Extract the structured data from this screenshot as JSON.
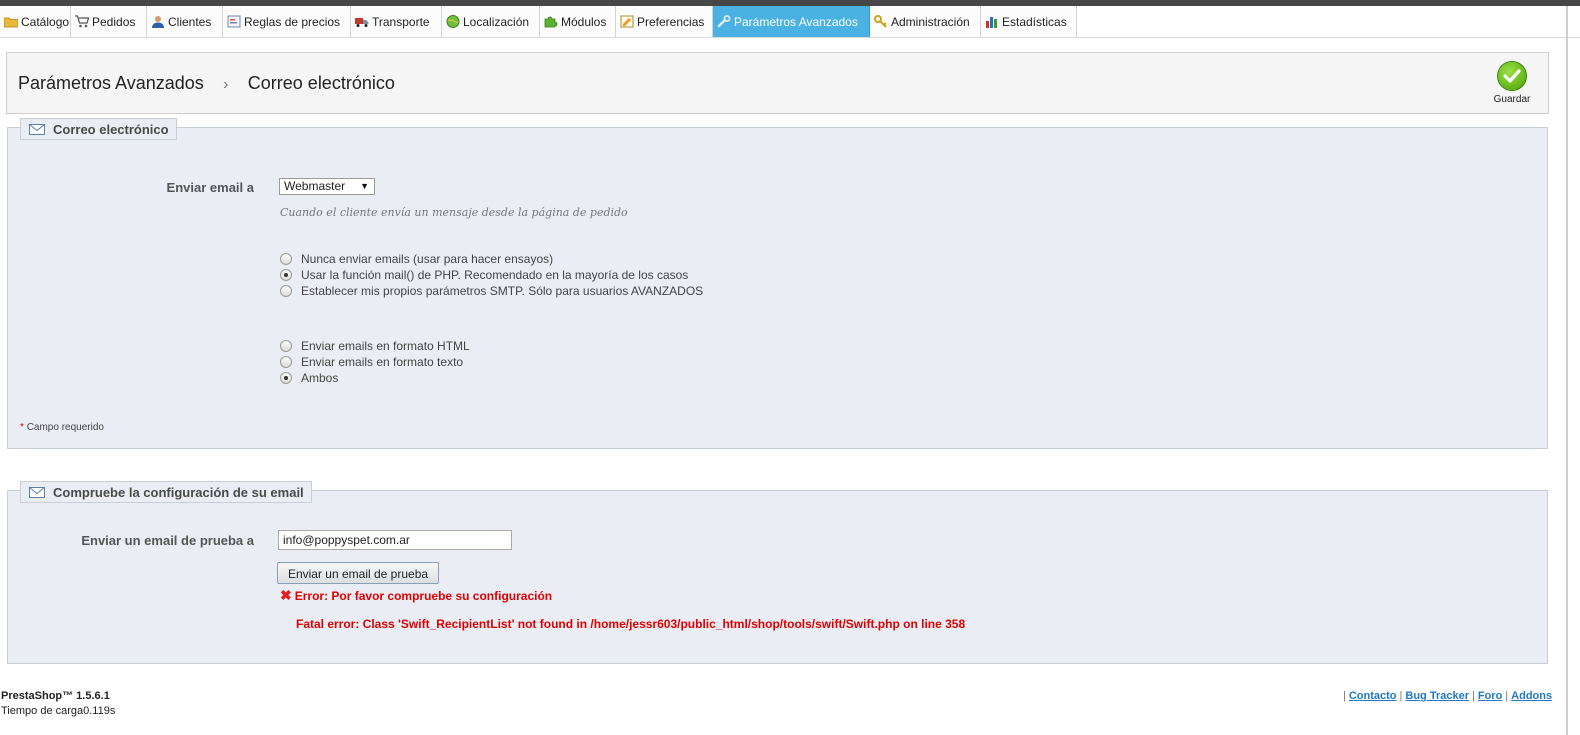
{
  "menu": {
    "tabs": [
      {
        "label": "Catálogo",
        "icon": "folder-icon",
        "active": false
      },
      {
        "label": "Pedidos",
        "icon": "cart-icon",
        "active": false
      },
      {
        "label": "Clientes",
        "icon": "user-icon",
        "active": false
      },
      {
        "label": "Reglas de precios",
        "icon": "price-rules-icon",
        "active": false
      },
      {
        "label": "Transporte",
        "icon": "truck-icon",
        "active": false
      },
      {
        "label": "Localización",
        "icon": "globe-icon",
        "active": false
      },
      {
        "label": "Módulos",
        "icon": "puzzle-icon",
        "active": false
      },
      {
        "label": "Preferencias",
        "icon": "preferences-icon",
        "active": false
      },
      {
        "label": "Parámetros Avanzados",
        "icon": "wrench-icon",
        "active": true
      },
      {
        "label": "Administración",
        "icon": "key-icon",
        "active": false
      },
      {
        "label": "Estadísticas",
        "icon": "bar-chart-icon",
        "active": false
      }
    ],
    "active_color": "#49b2e3"
  },
  "breadcrumb": {
    "parent": "Parámetros Avanzados",
    "separator": "›",
    "current": "Correo electrónico"
  },
  "toolbar": {
    "save_label": "Guardar",
    "save_icon": "checkmark-icon",
    "save_color": "#6cbf1e"
  },
  "email_settings": {
    "legend": "Correo electrónico",
    "send_to_label": "Enviar email a",
    "send_to_value": "Webmaster",
    "send_to_hint": "Cuando el cliente envía un mensaje desde la página de pedido",
    "method_options": [
      {
        "label": "Nunca enviar emails (usar para hacer ensayos)",
        "checked": false
      },
      {
        "label": "Usar la función mail() de PHP. Recomendado en la mayoría de los casos",
        "checked": true
      },
      {
        "label": "Establecer mis propios parámetros SMTP. Sólo para usuarios AVANZADOS",
        "checked": false
      }
    ],
    "format_options": [
      {
        "label": "Enviar emails en formato HTML",
        "checked": false
      },
      {
        "label": "Enviar emails en formato texto",
        "checked": false
      },
      {
        "label": "Ambos",
        "checked": true
      }
    ],
    "required_star": "*",
    "required_text": "Campo requerido"
  },
  "test_email": {
    "legend": "Compruebe la configuración de su email",
    "label": "Enviar un email de prueba a",
    "value": "info@poppyspet.com.ar",
    "button": "Enviar un email de prueba",
    "error": "Error: Por favor compruebe su configuración",
    "fatal": "Fatal error: Class 'Swift_RecipientList' not found in /home/jessr603/public_html/shop/tools/swift/Swift.php on line 358",
    "error_color": "#e00000"
  },
  "footer": {
    "version": "PrestaShop™ 1.5.6.1",
    "load_time": "Tiempo de carga0.119s",
    "links": [
      "Contacto",
      "Bug Tracker",
      "Foro",
      "Addons"
    ],
    "pipe": "|"
  }
}
